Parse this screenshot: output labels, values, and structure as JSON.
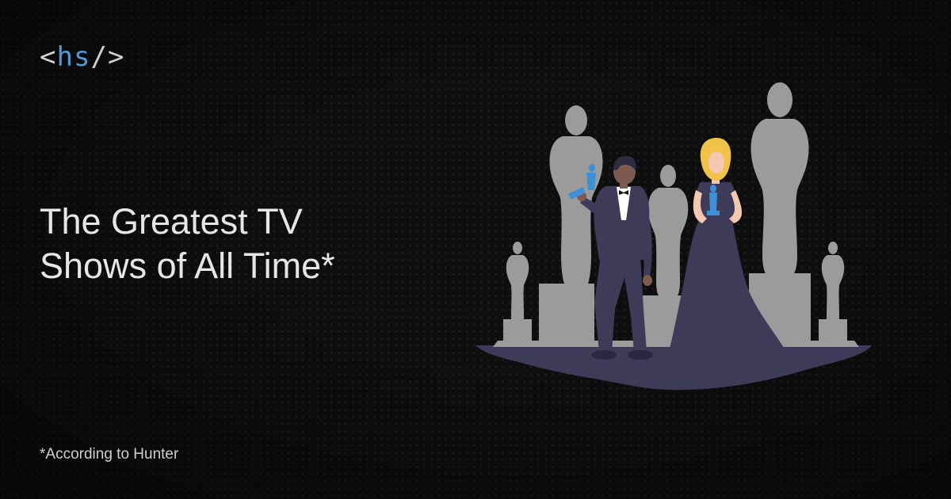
{
  "logo": {
    "open": "<",
    "text": "hs",
    "close": "/>",
    "accent_color": "#4f9ad8"
  },
  "headline": {
    "line1": "The Greatest TV",
    "line2": "Shows of All Time*"
  },
  "footnote": "*According to Hunter",
  "illustration": {
    "icon": "award-ceremony-illustration",
    "statue_color": "#9b9b9b",
    "outfit_color": "#3e3b59",
    "trophy_color": "#3d8fd6"
  }
}
